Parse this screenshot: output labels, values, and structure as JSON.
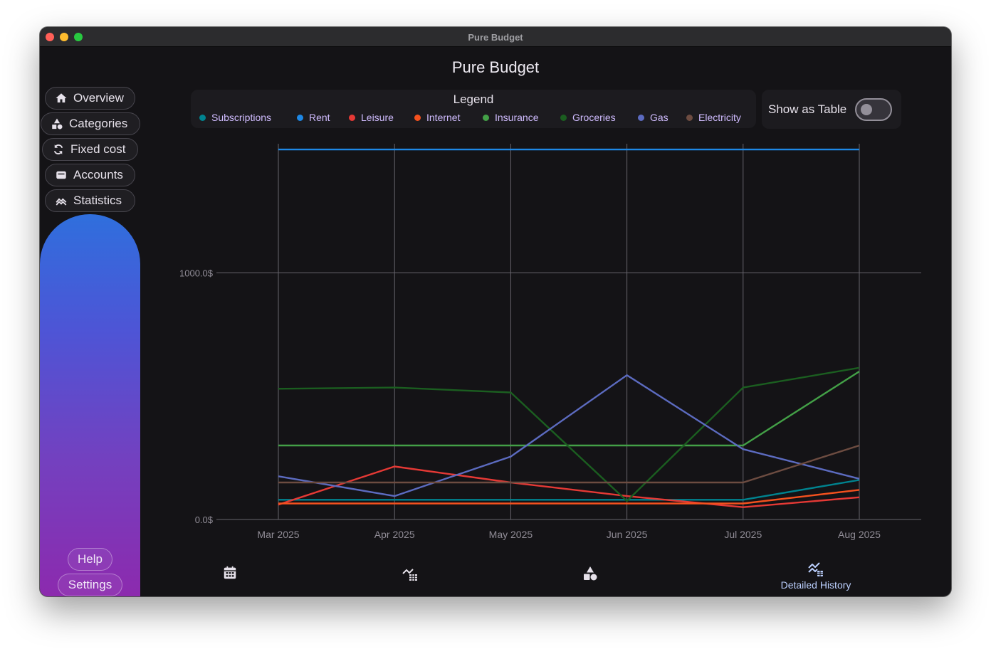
{
  "window": {
    "title": "Pure Budget"
  },
  "app": {
    "title": "Pure Budget"
  },
  "sidebar": {
    "items": [
      {
        "label": "Overview",
        "icon": "home-icon"
      },
      {
        "label": "Categories",
        "icon": "shapes-icon"
      },
      {
        "label": "Fixed cost",
        "icon": "sync-icon"
      },
      {
        "label": "Accounts",
        "icon": "wallet-icon"
      },
      {
        "label": "Statistics",
        "icon": "trending-icon"
      }
    ],
    "help_label": "Help",
    "settings_label": "Settings"
  },
  "legend": {
    "title": "Legend"
  },
  "controls": {
    "show_as_table_label": "Show as Table",
    "show_as_table": false
  },
  "bottom_nav": {
    "items": [
      {
        "icon": "calendar-icon",
        "label": ""
      },
      {
        "icon": "chart-table-icon",
        "label": ""
      },
      {
        "icon": "categories-icon",
        "label": ""
      },
      {
        "icon": "detailed-history-icon",
        "label": "Detailed History"
      }
    ],
    "selected": 3
  },
  "colors": {
    "background": "#141316",
    "accent": "#bcd0ff",
    "legend_text": "#d0bcff",
    "grid": "#66646c"
  },
  "chart_data": {
    "type": "line",
    "x": [
      "Mar 2025",
      "Apr 2025",
      "May 2025",
      "Jun 2025",
      "Jul 2025",
      "Aug 2025"
    ],
    "ytick_labels": [
      "0.0$",
      "1000.0$"
    ],
    "ylim": [
      0,
      1500
    ],
    "grid": true,
    "legend_position": "top",
    "series": [
      {
        "name": "Subscriptions",
        "color": "#00838f",
        "values": [
          80,
          80,
          80,
          80,
          80,
          160
        ]
      },
      {
        "name": "Rent",
        "color": "#1e88e5",
        "values": [
          1500,
          1500,
          1500,
          1500,
          1500,
          1500
        ]
      },
      {
        "name": "Leisure",
        "color": "#e53935",
        "values": [
          60,
          215,
          150,
          95,
          50,
          90
        ]
      },
      {
        "name": "Internet",
        "color": "#f4511e",
        "values": [
          65,
          65,
          65,
          65,
          65,
          120
        ]
      },
      {
        "name": "Insurance",
        "color": "#43a047",
        "values": [
          300,
          300,
          300,
          300,
          300,
          600
        ]
      },
      {
        "name": "Groceries",
        "color": "#1b5e20",
        "values": [
          530,
          535,
          515,
          75,
          535,
          615
        ]
      },
      {
        "name": "Gas",
        "color": "#5c6bc0",
        "values": [
          175,
          95,
          255,
          585,
          285,
          165
        ]
      },
      {
        "name": "Electricity",
        "color": "#6d4c41",
        "values": [
          150,
          150,
          150,
          150,
          150,
          300
        ]
      }
    ]
  }
}
